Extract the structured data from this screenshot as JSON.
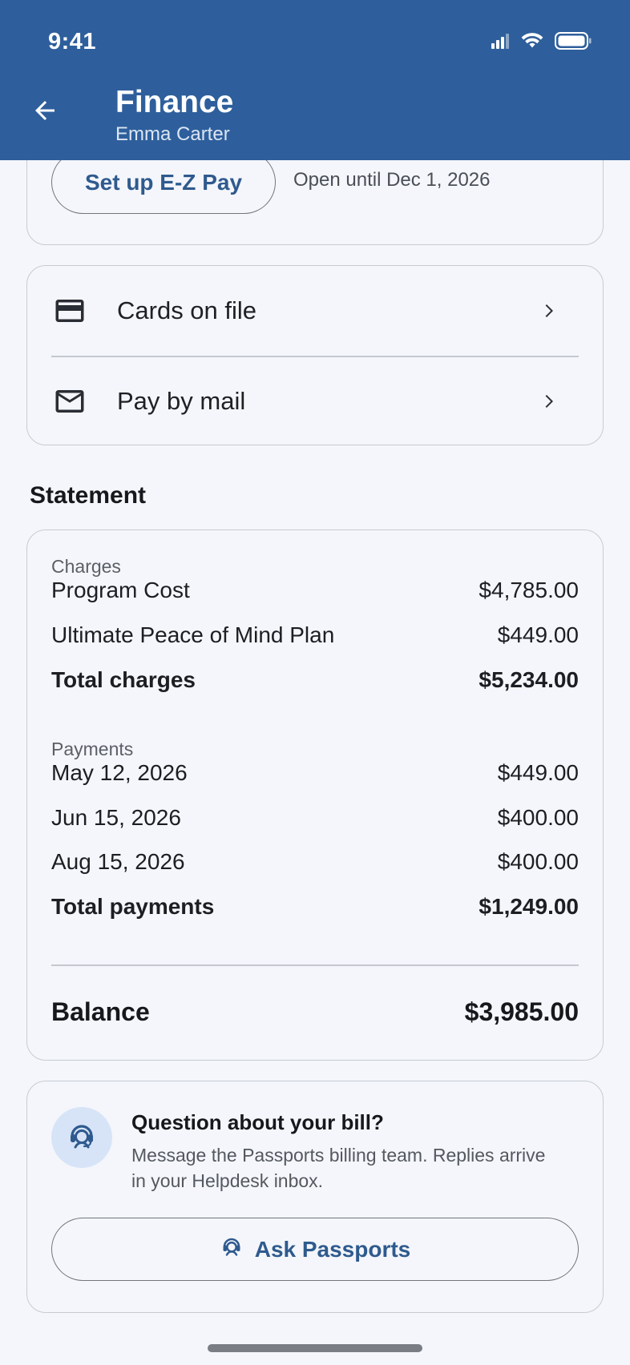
{
  "status_bar": {
    "time": "9:41"
  },
  "header": {
    "title": "Finance",
    "subtitle": "Emma Carter",
    "back_icon": "arrow-left-icon"
  },
  "ez_pay": {
    "button_label": "Set up E-Z Pay",
    "note": "Open until Dec 1, 2026"
  },
  "payment_options": [
    {
      "label": "Cards on file",
      "icon": "credit-card-icon"
    },
    {
      "label": "Pay by mail",
      "icon": "mail-icon"
    }
  ],
  "statement": {
    "heading": "Statement",
    "charges_label": "Charges",
    "charges": [
      {
        "label": "Program Cost",
        "amount": "$4,785.00"
      },
      {
        "label": "Ultimate Peace of Mind Plan",
        "amount": "$449.00"
      }
    ],
    "total_charges": {
      "label": "Total charges",
      "amount": "$5,234.00"
    },
    "payments_label": "Payments",
    "payments": [
      {
        "label": "May 12, 2026",
        "amount": "$449.00"
      },
      {
        "label": "Jun 15, 2026",
        "amount": "$400.00"
      },
      {
        "label": "Aug 15, 2026",
        "amount": "$400.00"
      }
    ],
    "total_payments": {
      "label": "Total payments",
      "amount": "$1,249.00"
    },
    "balance": {
      "label": "Balance",
      "amount": "$3,985.00"
    }
  },
  "help": {
    "title": "Question about your bill?",
    "body": "Message the Passports billing team. Replies arrive in your Helpdesk inbox.",
    "button_label": "Ask Passports",
    "icon": "headset-agent-icon"
  },
  "colors": {
    "header_bg": "#2e5f9c",
    "accent": "#2f5a8e",
    "page_bg": "#f4f6fb",
    "avatar_bg": "#d7e4f7"
  }
}
